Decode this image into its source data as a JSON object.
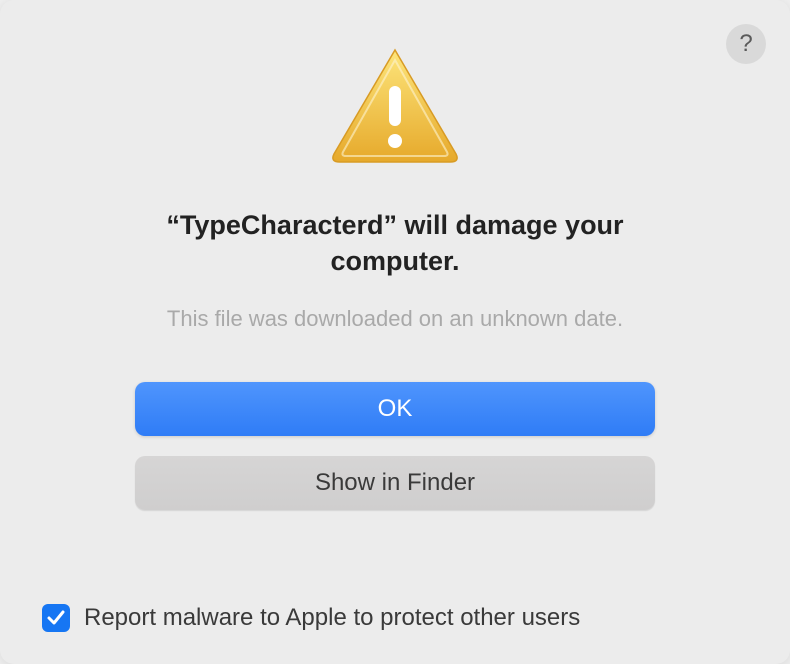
{
  "dialog": {
    "title_prefix": "“",
    "app_name": "TypeCharacterd",
    "title_suffix": "” will damage your computer.",
    "subtitle": "This file was downloaded on an unknown date.",
    "primary_button_label": "OK",
    "secondary_button_label": "Show in Finder",
    "help_button_label": "?",
    "checkbox_label": "Report malware to Apple to protect other users",
    "checkbox_checked": true
  }
}
